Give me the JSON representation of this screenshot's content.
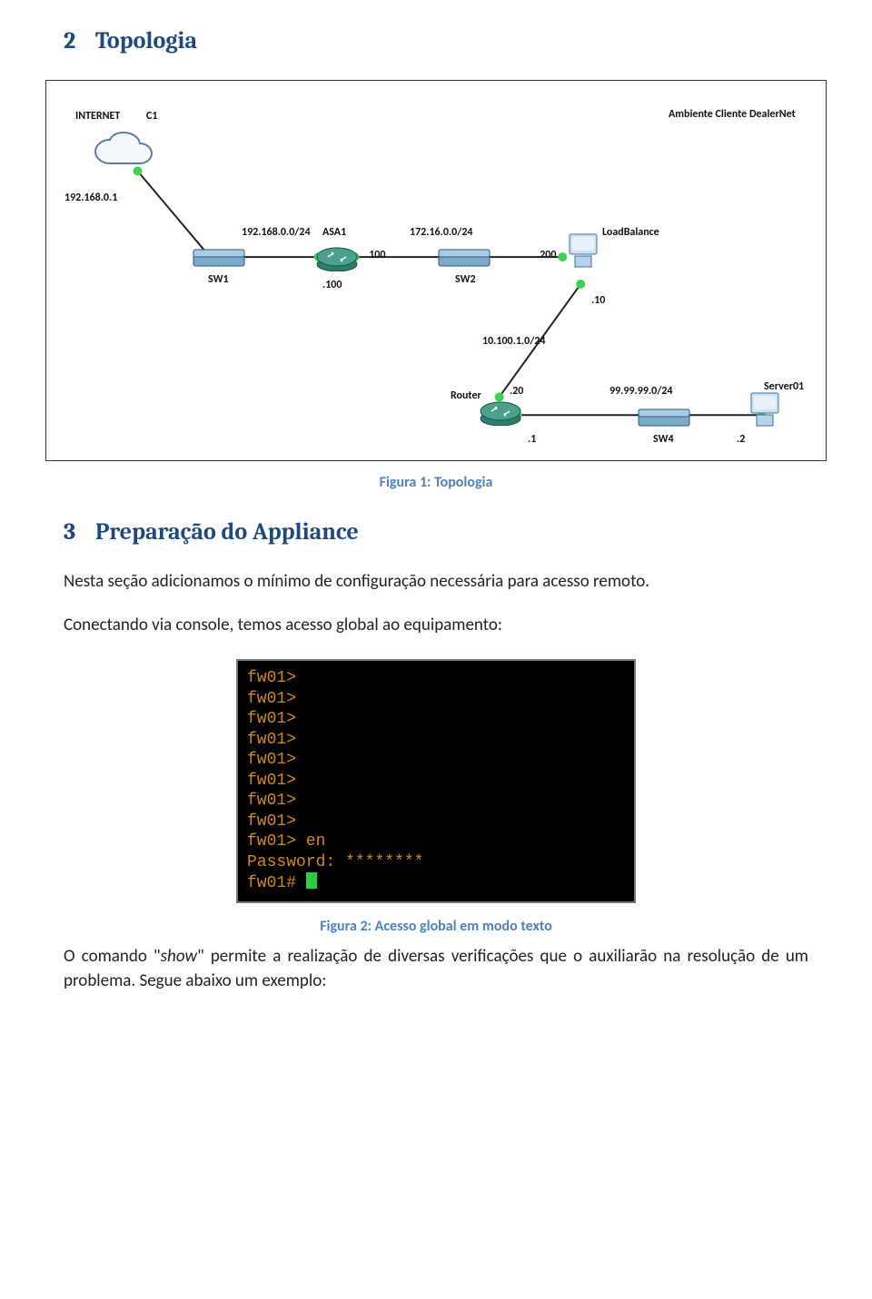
{
  "headings": {
    "h2_num": "2",
    "h2_title": "Topologia",
    "h3_num": "3",
    "h3_title": "Preparação do Appliance"
  },
  "captions": {
    "fig1": "Figura 1: Topologia",
    "fig2": "Figura 2: Acesso global em modo texto"
  },
  "paragraphs": {
    "p1": "Nesta seção adicionamos o mínimo de configuração necessária para acesso remoto.",
    "p2": "Conectando via console, temos acesso global ao equipamento:",
    "p3_pre": "O comando \"",
    "p3_show": "show",
    "p3_post": "\" permite a realização de diversas verificações que o auxiliarão na resolução de um problema. Segue abaixo um exemplo:"
  },
  "topology": {
    "internet_label": "INTERNET",
    "c1_label": "C1",
    "ip_left": "192.168.0.1",
    "net1": "192.168.0.0/24",
    "sw1": "SW1",
    "asa1": "ASA1",
    "asa1_ip": ".100",
    "asa1_ip_below": ".100",
    "net2": "172.16.0.0/24",
    "sw2": "SW2",
    "lb_ip": ".200",
    "lb_label": "LoadBalance",
    "lb_ip2": ".10",
    "net3": "10.100.1.0/24",
    "router_label": "Router",
    "router_ip": ".20",
    "router_ip2": ".1",
    "net4": "99.99.99.0/24",
    "sw4": "SW4",
    "srv_ip": ".2",
    "srv_label": "Server01",
    "env_label": "Ambiente Cliente DealerNet"
  },
  "terminal": {
    "l1": "fw01>",
    "l2": "fw01>",
    "l3": "fw01>",
    "l4": "fw01>",
    "l5": "fw01>",
    "l6": "fw01>",
    "l7": "fw01>",
    "l8": "fw01>",
    "l9": "fw01> en",
    "l10": "Password: ********",
    "l11": "fw01# "
  }
}
